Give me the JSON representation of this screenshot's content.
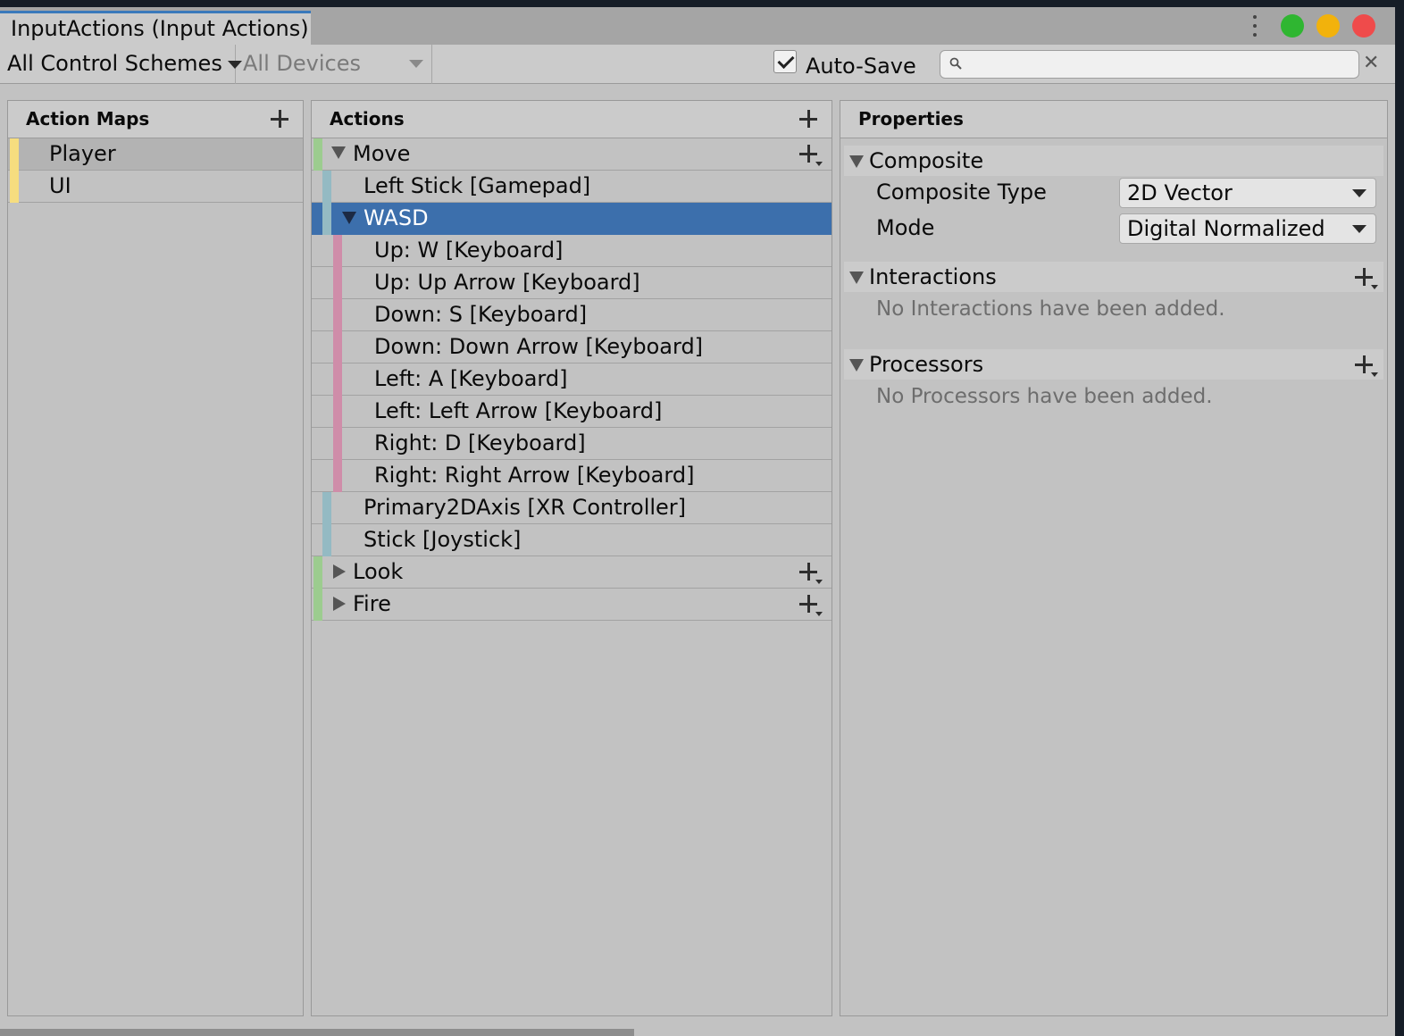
{
  "window": {
    "tab_title": "InputActions (Input Actions)",
    "control_colors": {
      "green": "#2fb631",
      "yellow": "#f2b20c",
      "red": "#ef4b4b"
    }
  },
  "toolbar": {
    "control_schemes": "All Control Schemes",
    "devices": "All Devices",
    "autosave_label": "Auto-Save",
    "autosave_checked": true,
    "search_value": "",
    "search_placeholder": ""
  },
  "action_maps": {
    "header": "Action Maps",
    "items": [
      {
        "label": "Player",
        "selected": true
      },
      {
        "label": "UI",
        "selected": false
      }
    ]
  },
  "actions": {
    "header": "Actions",
    "rows": [
      {
        "label": "Move",
        "kind": "action",
        "expanded": true
      },
      {
        "label": "Left Stick [Gamepad]",
        "kind": "binding"
      },
      {
        "label": "WASD",
        "kind": "composite",
        "expanded": true,
        "selected": true
      },
      {
        "label": "Up: W [Keyboard]",
        "kind": "part"
      },
      {
        "label": "Up: Up Arrow [Keyboard]",
        "kind": "part"
      },
      {
        "label": "Down: S [Keyboard]",
        "kind": "part"
      },
      {
        "label": "Down: Down Arrow [Keyboard]",
        "kind": "part"
      },
      {
        "label": "Left: A [Keyboard]",
        "kind": "part"
      },
      {
        "label": "Left: Left Arrow [Keyboard]",
        "kind": "part"
      },
      {
        "label": "Right: D [Keyboard]",
        "kind": "part"
      },
      {
        "label": "Right: Right Arrow [Keyboard]",
        "kind": "part"
      },
      {
        "label": "Primary2DAxis [XR Controller]",
        "kind": "binding"
      },
      {
        "label": "Stick [Joystick]",
        "kind": "binding"
      },
      {
        "label": "Look",
        "kind": "action",
        "expanded": false
      },
      {
        "label": "Fire",
        "kind": "action",
        "expanded": false
      }
    ]
  },
  "properties": {
    "header": "Properties",
    "composite": {
      "title": "Composite",
      "type_label": "Composite Type",
      "type_value": "2D Vector",
      "mode_label": "Mode",
      "mode_value": "Digital Normalized"
    },
    "interactions": {
      "title": "Interactions",
      "empty": "No Interactions have been added."
    },
    "processors": {
      "title": "Processors",
      "empty": "No Processors have been added."
    }
  },
  "colors": {
    "map_bar": "#f6dd7f",
    "action_bar": "#9ccc8f",
    "binding_bar": "#94bac3",
    "part_bar": "#cf8da9",
    "selection": "#3c6fac"
  }
}
